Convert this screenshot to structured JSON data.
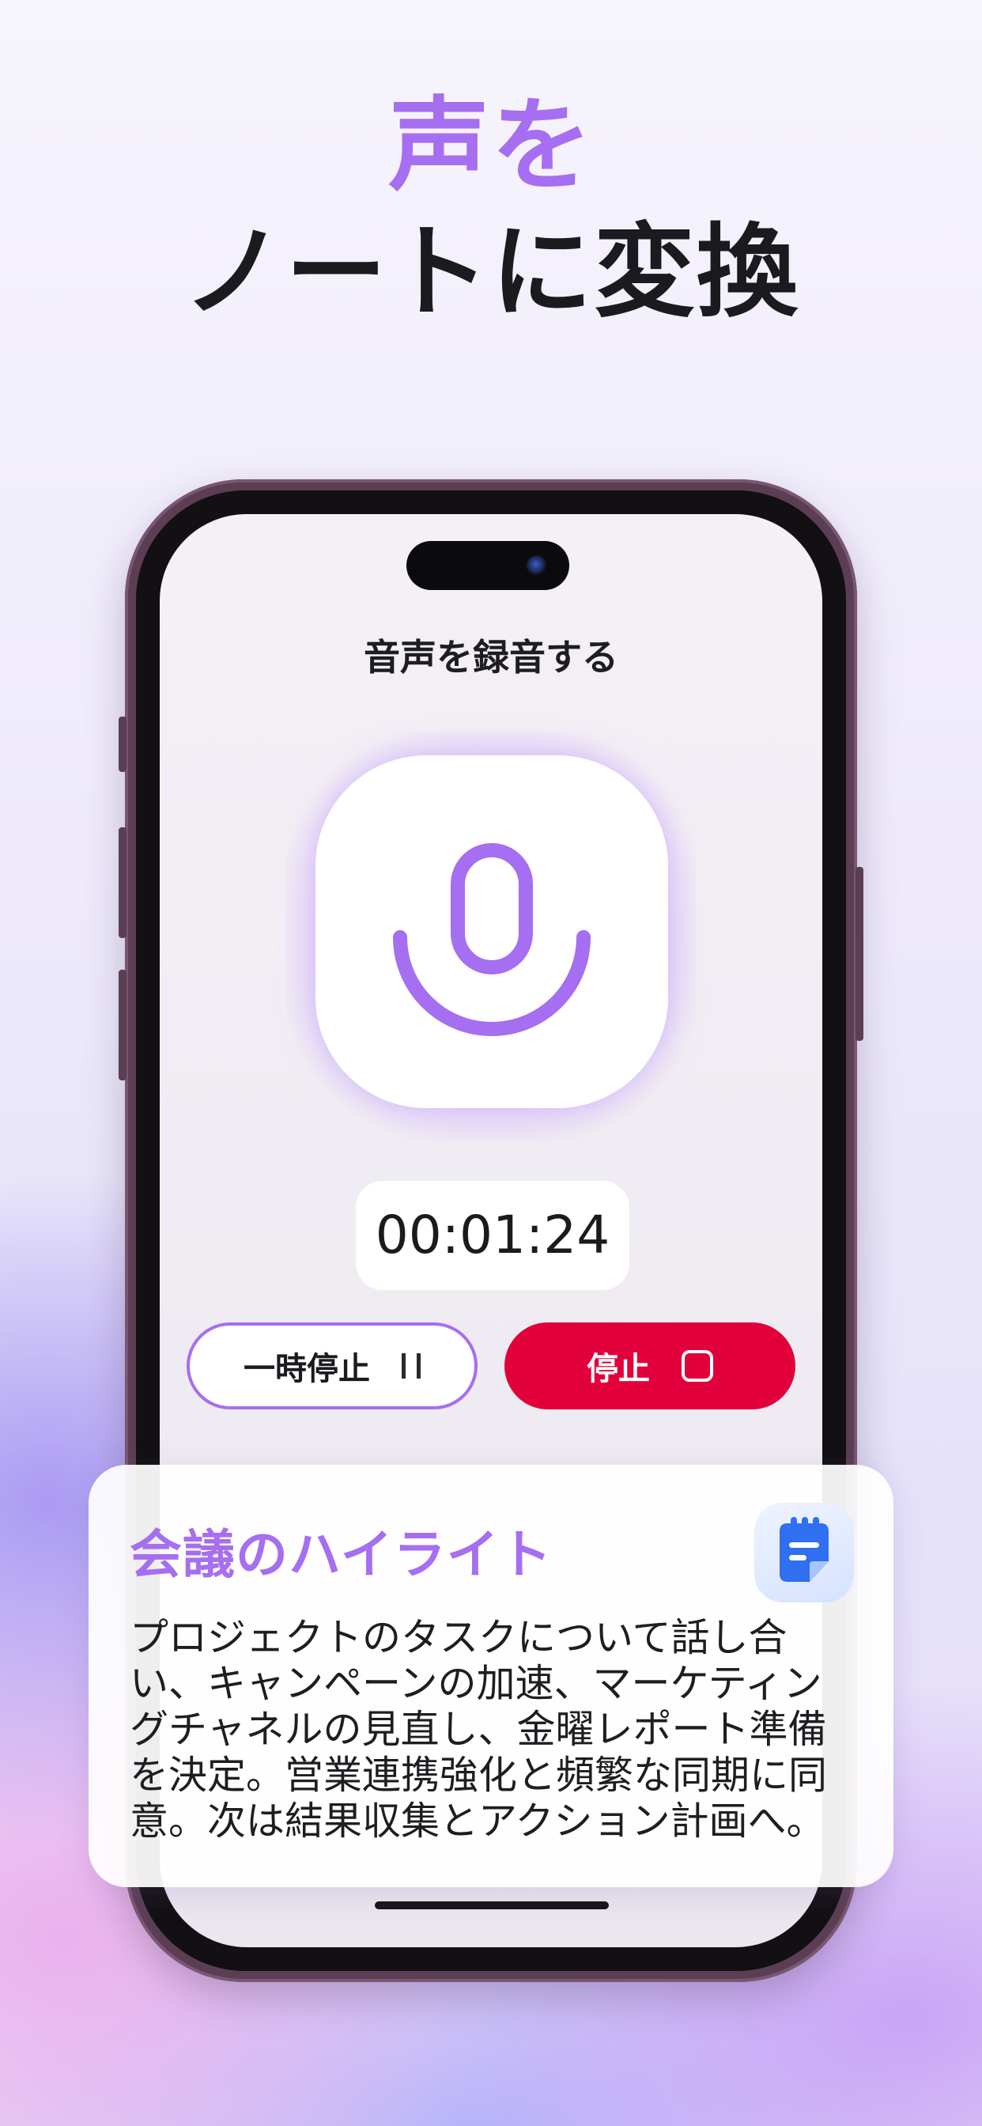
{
  "headline": {
    "line1": "声を",
    "line2": "ノートに変換"
  },
  "screen": {
    "title": "音声を録音する",
    "mic_icon": "microphone-icon",
    "timer": "00:01:24",
    "pause_button": {
      "label": "一時停止",
      "icon": "pause-icon"
    },
    "stop_button": {
      "label": "停止",
      "icon": "stop-icon"
    }
  },
  "highlight_card": {
    "title": "会議のハイライト",
    "icon": "note-icon",
    "body": "プロジェクトのタスクについて話し合い、キャンペーンの加速、マーケティングチャネルの見直し、金曜レポート準備を決定。営業連携強化と頻繁な同期に同意。次は結果収集とアクション計画へ。"
  },
  "colors": {
    "accent_purple": "#a66ef0",
    "stop_red": "#e2003a",
    "note_blue": "#2f6ff0",
    "text_dark": "#1b1b1f"
  }
}
